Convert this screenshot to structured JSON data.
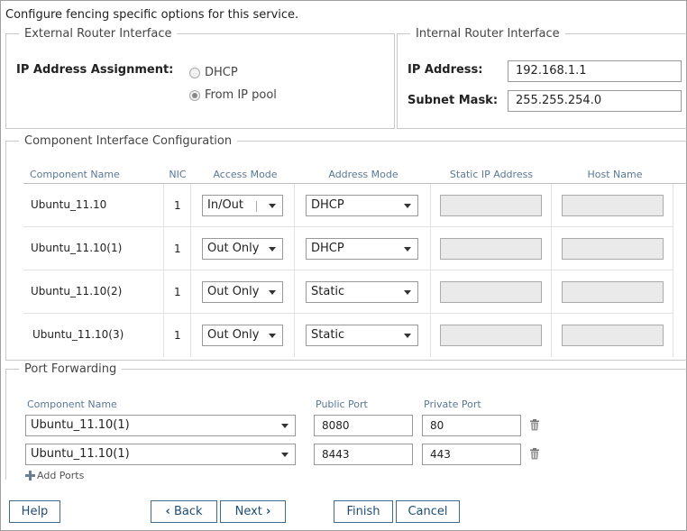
{
  "intro_text": "Configure fencing specific options for this service.",
  "external": {
    "legend": "External Router Interface",
    "ip_assign_label": "IP Address Assignment:",
    "options": [
      {
        "label": "DHCP",
        "checked": false
      },
      {
        "label": "From IP pool",
        "checked": true
      }
    ]
  },
  "internal": {
    "legend": "Internal Router Interface",
    "ip_label": "IP Address:",
    "ip_value": "192.168.1.1",
    "mask_label": "Subnet Mask:",
    "mask_value": "255.255.254.0"
  },
  "component_config": {
    "legend": "Component Interface Configuration",
    "columns": [
      "Component Name",
      "NIC",
      "Access Mode",
      "Address Mode",
      "Static IP Address",
      "Host Name"
    ],
    "rows": [
      {
        "name": "Ubuntu_11.10",
        "nic": "1",
        "access": "In/Out",
        "address": "DHCP"
      },
      {
        "name": "Ubuntu_11.10(1)",
        "nic": "1",
        "access": "Out Only",
        "address": "DHCP"
      },
      {
        "name": "Ubuntu_11.10(2)",
        "nic": "1",
        "access": "Out Only",
        "address": "Static"
      },
      {
        "name": "Ubuntu_11.10(3)",
        "nic": "1",
        "access": "Out Only",
        "address": "Static"
      }
    ]
  },
  "port_forwarding": {
    "legend": "Port Forwarding",
    "columns": [
      "Component Name",
      "Public Port",
      "Private Port"
    ],
    "rows": [
      {
        "component": "Ubuntu_11.10(1)",
        "public": "8080",
        "private": "80"
      },
      {
        "component": "Ubuntu_11.10(1)",
        "public": "8443",
        "private": "443"
      }
    ],
    "add_label": "Add Ports"
  },
  "buttons": {
    "help": "Help",
    "back": "Back",
    "next": "Next",
    "finish": "Finish",
    "cancel": "Cancel"
  },
  "colors": {
    "button_border": "#3d6a8e",
    "header_text": "#5a7896"
  }
}
